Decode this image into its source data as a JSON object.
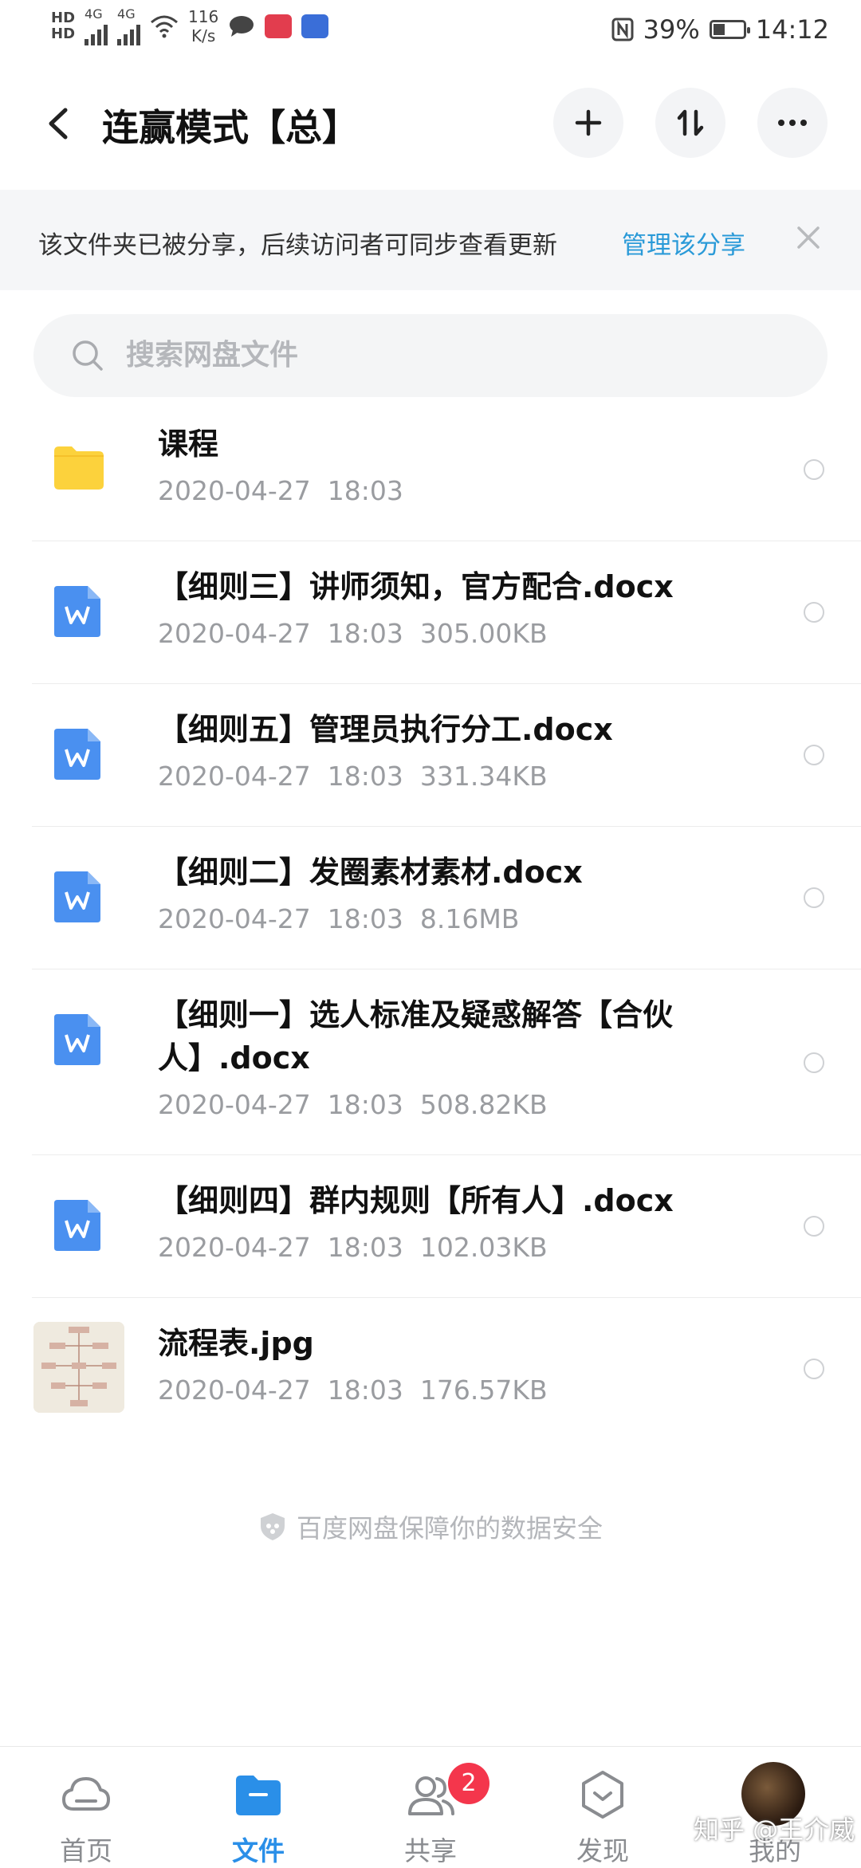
{
  "status_bar": {
    "hd1": "HD",
    "hd2": "HD",
    "net1": "4G",
    "net2": "4G",
    "speed_value": "116",
    "speed_unit": "K/s",
    "battery": "39%",
    "time": "14:12"
  },
  "header": {
    "title": "连赢模式【总】"
  },
  "banner": {
    "text": "该文件夹已被分享，后续访问者可同步查看更新",
    "link": "管理该分享"
  },
  "search": {
    "placeholder": "搜索网盘文件"
  },
  "files": [
    {
      "name": "课程",
      "date": "2020-04-27",
      "time": "18:03",
      "size": "",
      "type": "folder"
    },
    {
      "name": "【细则三】讲师须知，官方配合.docx",
      "date": "2020-04-27",
      "time": "18:03",
      "size": "305.00KB",
      "type": "word"
    },
    {
      "name": "【细则五】管理员执行分工.docx",
      "date": "2020-04-27",
      "time": "18:03",
      "size": "331.34KB",
      "type": "word"
    },
    {
      "name": "【细则二】发圈素材素材.docx",
      "date": "2020-04-27",
      "time": "18:03",
      "size": "8.16MB",
      "type": "word"
    },
    {
      "name": "【细则一】选人标准及疑惑解答【合伙人】.docx",
      "date": "2020-04-27",
      "time": "18:03",
      "size": "508.82KB",
      "type": "word"
    },
    {
      "name": "【细则四】群内规则【所有人】.docx",
      "date": "2020-04-27",
      "time": "18:03",
      "size": "102.03KB",
      "type": "word"
    },
    {
      "name": "流程表.jpg",
      "date": "2020-04-27",
      "time": "18:03",
      "size": "176.57KB",
      "type": "image"
    }
  ],
  "footer_note": "百度网盘保障你的数据安全",
  "nav": {
    "home": "首页",
    "files": "文件",
    "share": "共享",
    "share_badge": "2",
    "discover": "发现",
    "mine": "我的"
  },
  "watermark": "知乎 @王介威",
  "colors": {
    "accent": "#2a8fe8",
    "link": "#2a9ad8",
    "folder": "#fcd23c",
    "word": "#4a90f0",
    "badge": "#f4364c"
  }
}
